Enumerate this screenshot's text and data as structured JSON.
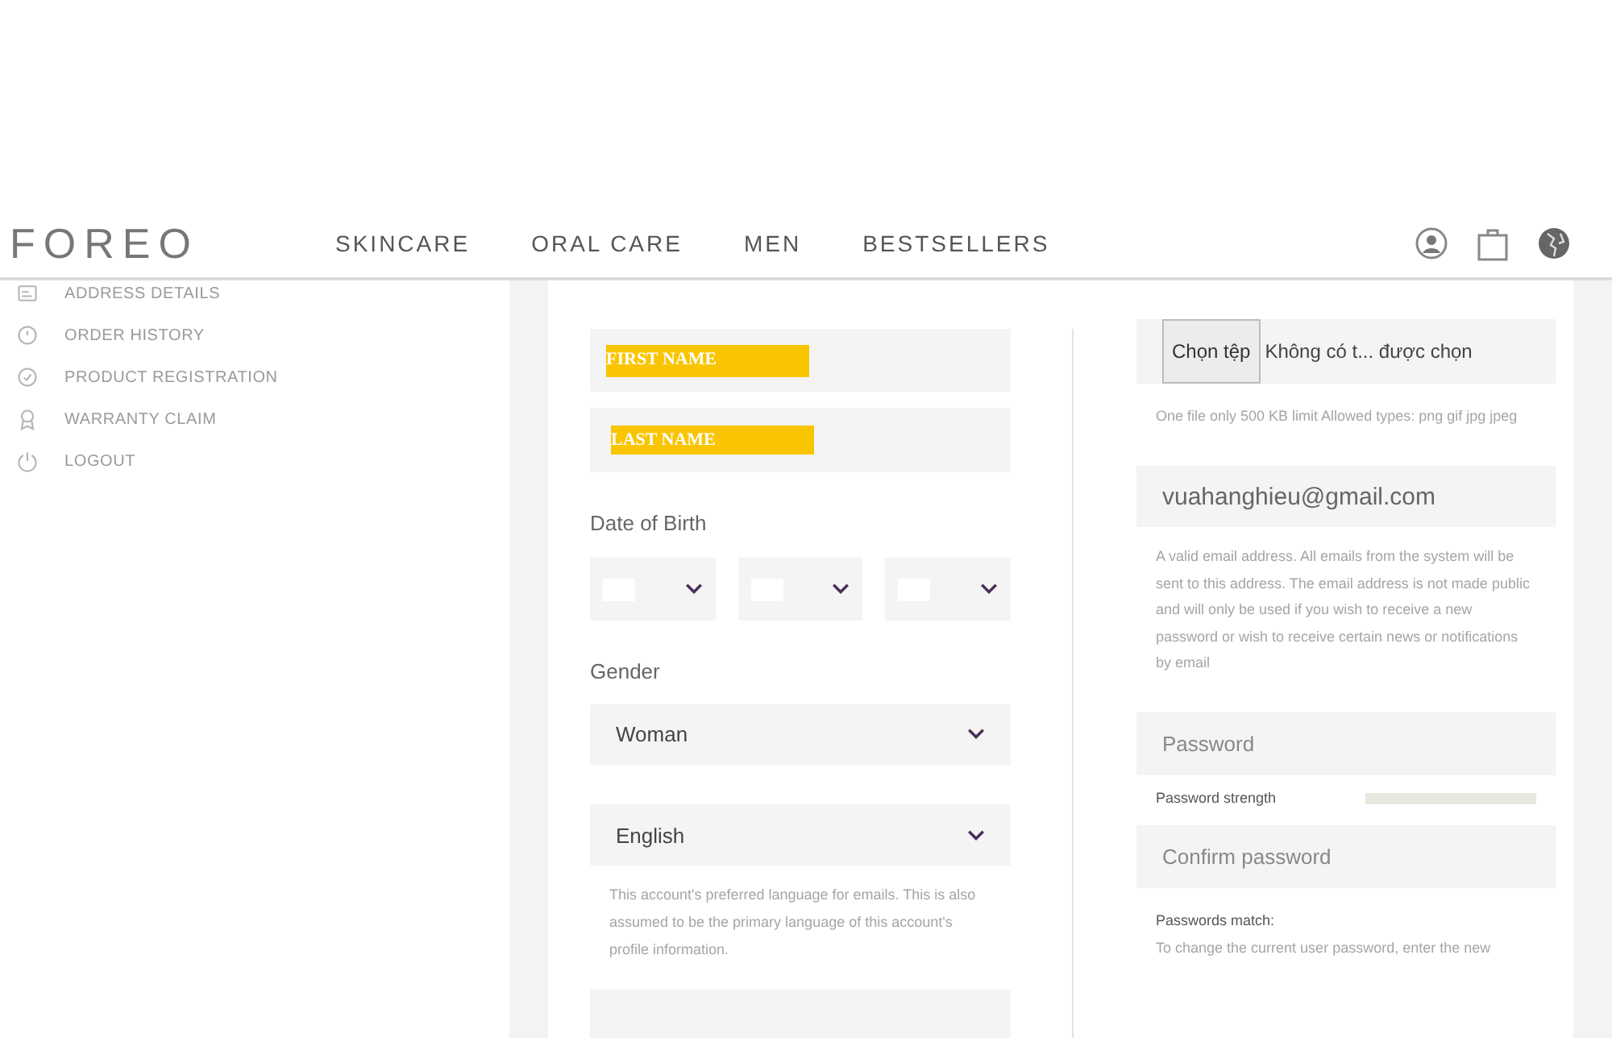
{
  "header": {
    "logo": "FOREO",
    "nav": [
      "SKINCARE",
      "ORAL CARE",
      "MEN",
      "BESTSELLERS"
    ]
  },
  "sidebar": {
    "items": [
      {
        "label": "ADDRESS DETAILS",
        "kind": "address"
      },
      {
        "label": "ORDER HISTORY",
        "kind": "history"
      },
      {
        "label": "PRODUCT REGISTRATION",
        "kind": "check"
      },
      {
        "label": "WARRANTY CLAIM",
        "kind": "award"
      },
      {
        "label": "LOGOUT",
        "kind": "power"
      }
    ]
  },
  "form": {
    "first_name": "FIRST NAME",
    "last_name": "LAST NAME",
    "dob_label": "Date of Birth",
    "gender_label": "Gender",
    "gender": "Woman",
    "language": "English",
    "language_help": "This account's preferred language for emails. This is also assumed to be the primary language of this account's profile information.",
    "file_button": "Chọn tệp",
    "file_status": "Không có t... được chọn",
    "file_help": "One file only 500 KB limit Allowed types: png gif jpg jpeg",
    "email": "vuahanghieu@gmail.com",
    "email_help": "A valid email address. All emails from the system will be sent to this address. The email address is not made public and will only be used if you wish to receive a new password or wish to receive certain news or notifications by email",
    "password_placeholder": "Password",
    "strength_label": "Password strength",
    "strength": {
      "level": 0
    },
    "confirm_placeholder": "Confirm password",
    "match_label": "Passwords match:",
    "change_help": "To change the current user password, enter the new"
  }
}
